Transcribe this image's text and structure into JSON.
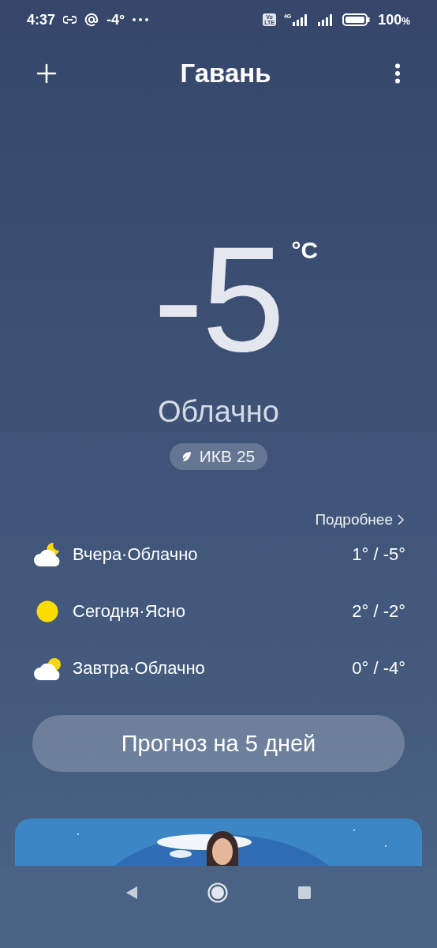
{
  "status_bar": {
    "time": "4:37",
    "temperature": "-4°",
    "volte": [
      "Vo",
      "LTE"
    ],
    "network": "4G",
    "battery": "100",
    "battery_unit": "%"
  },
  "header": {
    "title": "Гавань"
  },
  "current": {
    "temperature": "-5",
    "unit": "°C",
    "condition": "Облачно",
    "aqi": "ИКВ 25"
  },
  "forecast": {
    "more_link": "Подробнее",
    "days": [
      {
        "kind": "cloud-moon",
        "label": "Вчера·Облачно",
        "range": "1° / -5°"
      },
      {
        "kind": "sun",
        "label": "Сегодня·Ясно",
        "range": "2° / -2°"
      },
      {
        "kind": "cloud-sun",
        "label": "Завтра·Облачно",
        "range": "0° / -4°"
      }
    ]
  },
  "forecast_button": {
    "label": "Прогноз на 5 дней"
  }
}
